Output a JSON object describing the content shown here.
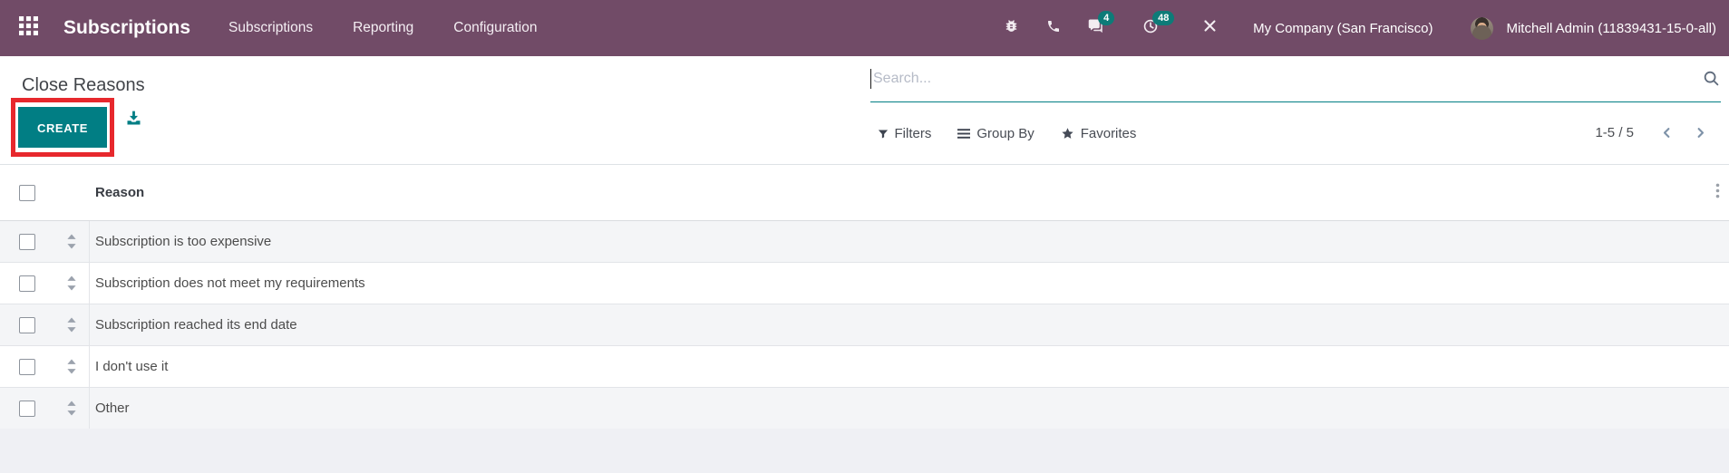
{
  "topbar": {
    "app_name": "Subscriptions",
    "menu_items": [
      {
        "label": "Subscriptions"
      },
      {
        "label": "Reporting"
      },
      {
        "label": "Configuration"
      }
    ],
    "message_badge": "4",
    "activity_badge": "48",
    "company_name": "My Company (San Francisco)",
    "user_name": "Mitchell Admin (11839431-15-0-all)"
  },
  "page": {
    "title": "Close Reasons",
    "create_button": "CREATE",
    "search_placeholder": "Search...",
    "filters_label": "Filters",
    "group_by_label": "Group By",
    "favorites_label": "Favorites",
    "pager_text": "1-5 / 5"
  },
  "table": {
    "reason_column": "Reason",
    "rows": [
      {
        "reason": "Subscription is too expensive"
      },
      {
        "reason": "Subscription does not meet my requirements"
      },
      {
        "reason": "Subscription reached its end date"
      },
      {
        "reason": "I don't use it"
      },
      {
        "reason": "Other"
      }
    ]
  },
  "icons": {
    "apps_grid": "3x3-squares",
    "bug": "bug",
    "phone": "phone-handset",
    "messages": "chat-bubbles",
    "activities": "clock",
    "developer_tools": "crossed-tools",
    "export": "download-tray",
    "filter": "funnel",
    "group_by": "three-lines",
    "favorites": "star",
    "search": "magnifier",
    "drag_handle": "up-down-triangles",
    "more_options": "vertical-dots",
    "pager_prev": "chevron-left",
    "pager_next": "chevron-right"
  },
  "colors": {
    "topbar_bg": "#714B67",
    "accent_teal": "#017e84",
    "badge_teal": "#0d7b78",
    "highlight_red": "#e7282d",
    "row_stripe": "#f4f5f7",
    "footer_band": "#eff0f4"
  }
}
